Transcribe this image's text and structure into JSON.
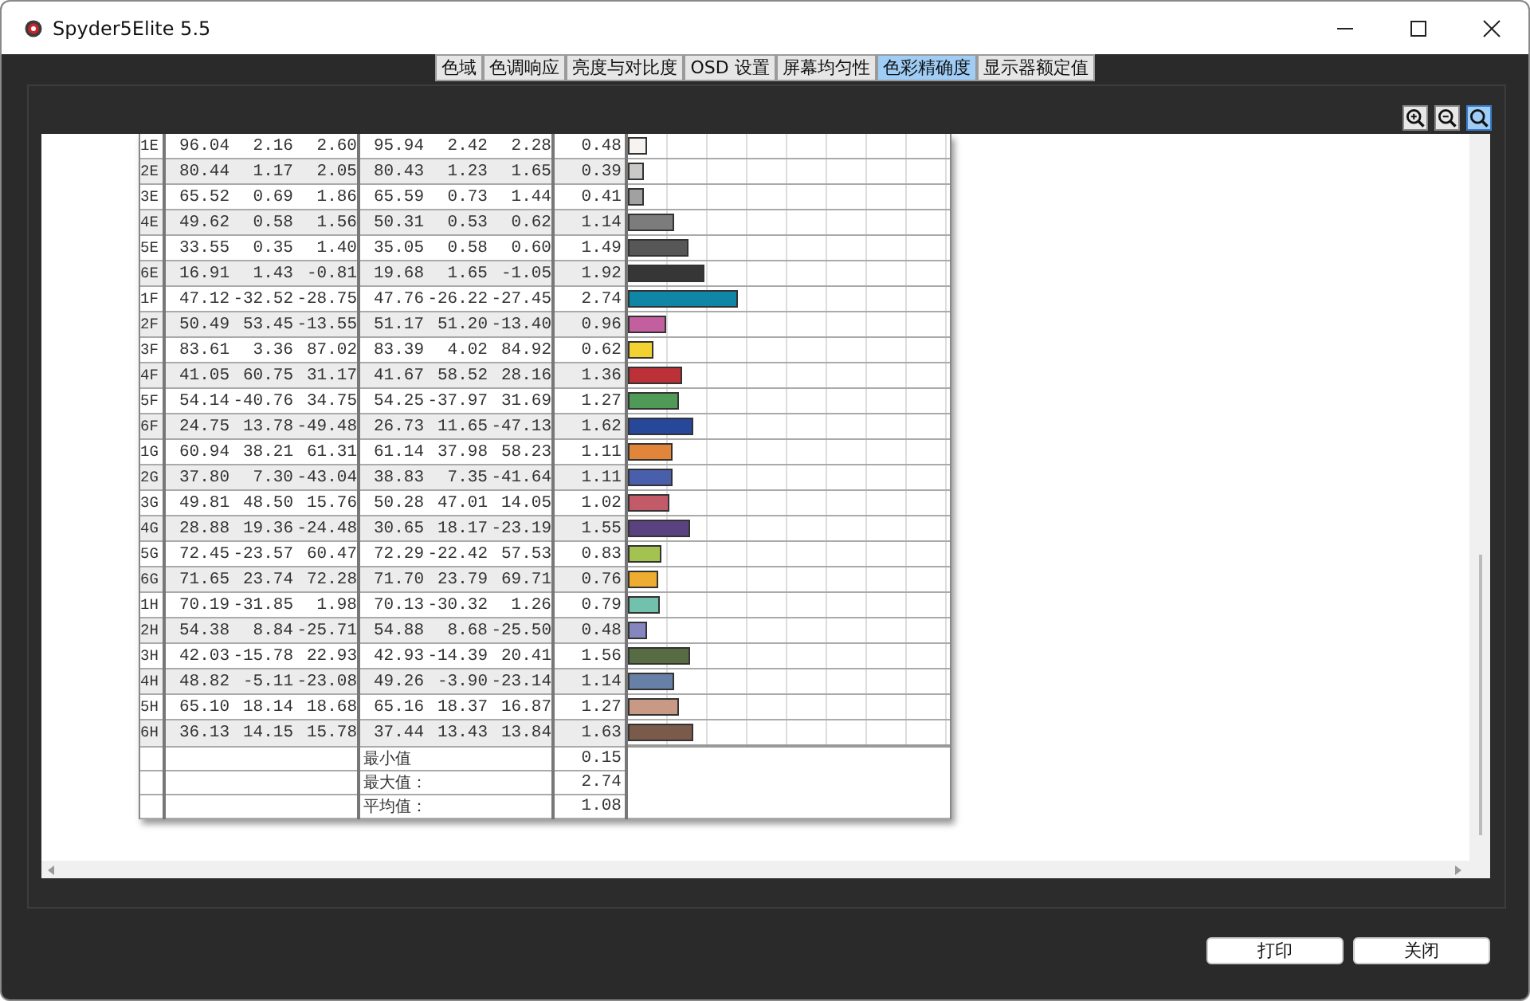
{
  "window": {
    "title": "Spyder5Elite 5.5"
  },
  "tabs": [
    {
      "label": "色域",
      "selected": false
    },
    {
      "label": "色调响应",
      "selected": false
    },
    {
      "label": "亮度与对比度",
      "selected": false
    },
    {
      "label": "OSD 设置",
      "selected": false
    },
    {
      "label": "屏幕均匀性",
      "selected": false
    },
    {
      "label": "色彩精确度",
      "selected": true
    },
    {
      "label": "显示器额定值",
      "selected": false
    }
  ],
  "zoom_tools": [
    {
      "kind": "zoom-in",
      "selected": false
    },
    {
      "kind": "zoom-out",
      "selected": false
    },
    {
      "kind": "zoom-fit",
      "selected": true
    }
  ],
  "table": {
    "rows": [
      {
        "patch": "1E",
        "l1": "96.04",
        "a1": "2.16",
        "b1": "2.60",
        "l2": "95.94",
        "a2": "2.42",
        "b2": "2.28",
        "de": "0.48",
        "color": "#f7f3f1"
      },
      {
        "patch": "2E",
        "l1": "80.44",
        "a1": "1.17",
        "b1": "2.05",
        "l2": "80.43",
        "a2": "1.23",
        "b2": "1.65",
        "de": "0.39",
        "color": "#cbc9c7"
      },
      {
        "patch": "3E",
        "l1": "65.52",
        "a1": "0.69",
        "b1": "1.86",
        "l2": "65.59",
        "a2": "0.73",
        "b2": "1.44",
        "de": "0.41",
        "color": "#a1a1a1"
      },
      {
        "patch": "4E",
        "l1": "49.62",
        "a1": "0.58",
        "b1": "1.56",
        "l2": "50.31",
        "a2": "0.53",
        "b2": "0.62",
        "de": "1.14",
        "color": "#7c7c7c"
      },
      {
        "patch": "5E",
        "l1": "33.55",
        "a1": "0.35",
        "b1": "1.40",
        "l2": "35.05",
        "a2": "0.58",
        "b2": "0.60",
        "de": "1.49",
        "color": "#575757"
      },
      {
        "patch": "6E",
        "l1": "16.91",
        "a1": "1.43",
        "b1": "-0.81",
        "l2": "19.68",
        "a2": "1.65",
        "b2": "-1.05",
        "de": "1.92",
        "color": "#363636"
      },
      {
        "patch": "1F",
        "l1": "47.12",
        "a1": "-32.52",
        "b1": "-28.75",
        "l2": "47.76",
        "a2": "-26.22",
        "b2": "-27.45",
        "de": "2.74",
        "color": "#0f86a6"
      },
      {
        "patch": "2F",
        "l1": "50.49",
        "a1": "53.45",
        "b1": "-13.55",
        "l2": "51.17",
        "a2": "51.20",
        "b2": "-13.40",
        "de": "0.96",
        "color": "#c45f9f"
      },
      {
        "patch": "3F",
        "l1": "83.61",
        "a1": "3.36",
        "b1": "87.02",
        "l2": "83.39",
        "a2": "4.02",
        "b2": "84.92",
        "de": "0.62",
        "color": "#f2d231"
      },
      {
        "patch": "4F",
        "l1": "41.05",
        "a1": "60.75",
        "b1": "31.17",
        "l2": "41.67",
        "a2": "58.52",
        "b2": "28.16",
        "de": "1.36",
        "color": "#bc3038"
      },
      {
        "patch": "5F",
        "l1": "54.14",
        "a1": "-40.76",
        "b1": "34.75",
        "l2": "54.25",
        "a2": "-37.97",
        "b2": "31.69",
        "de": "1.27",
        "color": "#4f9a56"
      },
      {
        "patch": "6F",
        "l1": "24.75",
        "a1": "13.78",
        "b1": "-49.48",
        "l2": "26.73",
        "a2": "11.65",
        "b2": "-47.13",
        "de": "1.62",
        "color": "#26479a"
      },
      {
        "patch": "1G",
        "l1": "60.94",
        "a1": "38.21",
        "b1": "61.31",
        "l2": "61.14",
        "a2": "37.98",
        "b2": "58.23",
        "de": "1.11",
        "color": "#e1853a"
      },
      {
        "patch": "2G",
        "l1": "37.80",
        "a1": "7.30",
        "b1": "-43.04",
        "l2": "38.83",
        "a2": "7.35",
        "b2": "-41.64",
        "de": "1.11",
        "color": "#4a5fab"
      },
      {
        "patch": "3G",
        "l1": "49.81",
        "a1": "48.50",
        "b1": "15.76",
        "l2": "50.28",
        "a2": "47.01",
        "b2": "14.05",
        "de": "1.02",
        "color": "#c25a67"
      },
      {
        "patch": "4G",
        "l1": "28.88",
        "a1": "19.36",
        "b1": "-24.48",
        "l2": "30.65",
        "a2": "18.17",
        "b2": "-23.19",
        "de": "1.55",
        "color": "#5a4280"
      },
      {
        "patch": "5G",
        "l1": "72.45",
        "a1": "-23.57",
        "b1": "60.47",
        "l2": "72.29",
        "a2": "-22.42",
        "b2": "57.53",
        "de": "0.83",
        "color": "#a3c24f"
      },
      {
        "patch": "6G",
        "l1": "71.65",
        "a1": "23.74",
        "b1": "72.28",
        "l2": "71.70",
        "a2": "23.79",
        "b2": "69.71",
        "de": "0.76",
        "color": "#eeac31"
      },
      {
        "patch": "1H",
        "l1": "70.19",
        "a1": "-31.85",
        "b1": "1.98",
        "l2": "70.13",
        "a2": "-30.32",
        "b2": "1.26",
        "de": "0.79",
        "color": "#72c1ad"
      },
      {
        "patch": "2H",
        "l1": "54.38",
        "a1": "8.84",
        "b1": "-25.71",
        "l2": "54.88",
        "a2": "8.68",
        "b2": "-25.50",
        "de": "0.48",
        "color": "#8585bf"
      },
      {
        "patch": "3H",
        "l1": "42.03",
        "a1": "-15.78",
        "b1": "22.93",
        "l2": "42.93",
        "a2": "-14.39",
        "b2": "20.41",
        "de": "1.56",
        "color": "#586c43"
      },
      {
        "patch": "4H",
        "l1": "48.82",
        "a1": "-5.11",
        "b1": "-23.08",
        "l2": "49.26",
        "a2": "-3.90",
        "b2": "-23.14",
        "de": "1.14",
        "color": "#6781a6"
      },
      {
        "patch": "5H",
        "l1": "65.10",
        "a1": "18.14",
        "b1": "18.68",
        "l2": "65.16",
        "a2": "18.37",
        "b2": "16.87",
        "de": "1.27",
        "color": "#c89a86"
      },
      {
        "patch": "6H",
        "l1": "36.13",
        "a1": "14.15",
        "b1": "15.78",
        "l2": "37.44",
        "a2": "13.43",
        "b2": "13.84",
        "de": "1.63",
        "color": "#7a5a4b"
      }
    ],
    "summary": [
      {
        "label": "最小值",
        "value": "0.15"
      },
      {
        "label": "最大值：",
        "value": "2.74"
      },
      {
        "label": "平均值：",
        "value": "1.08"
      }
    ]
  },
  "buttons": [
    "打印",
    "关闭"
  ]
}
